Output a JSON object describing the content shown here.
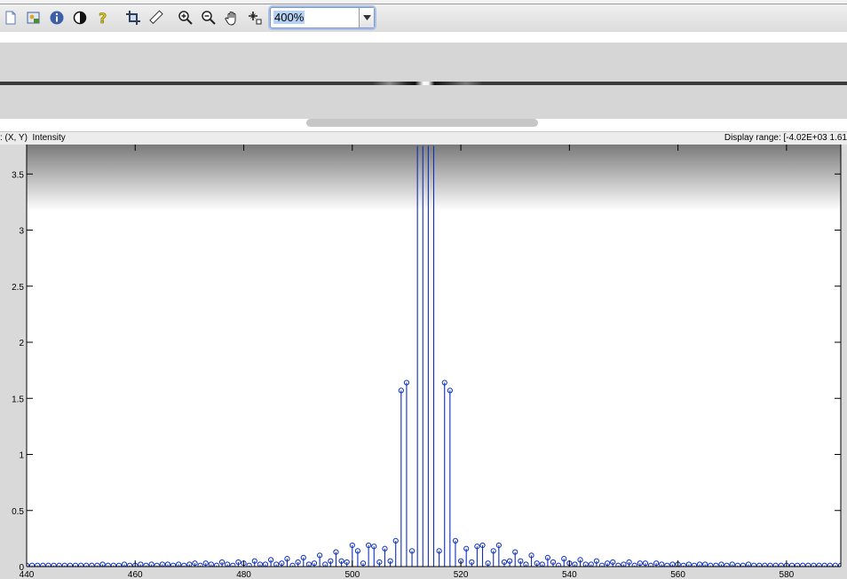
{
  "toolbar": {
    "icons": [
      "new-document-icon",
      "open-image-icon",
      "info-icon",
      "contrast-icon",
      "help-icon",
      "crop-icon",
      "measure-distance-icon",
      "zoom-in-icon",
      "zoom-out-icon",
      "pan-hand-icon",
      "pixel-region-icon"
    ],
    "zoom_value": "400%"
  },
  "status": {
    "pixel_info_label": ": (X, Y)  Intensity",
    "display_range_label": "Display range: [-4.02E+03 1.61"
  },
  "colors": {
    "stem": "#0c2fbe",
    "axes_bg": "#ffffff",
    "panel_bg": "#d9d9d9"
  },
  "chart_data": {
    "type": "scatter",
    "style": "stem",
    "x_range": [
      440,
      590
    ],
    "y_range": [
      0,
      3.75
    ],
    "x_ticks": [
      "440",
      "460",
      "480",
      "500",
      "520",
      "540",
      "560",
      "580"
    ],
    "y_ticks": [
      "0",
      "0.5",
      "1",
      "1.5",
      "2",
      "2.5",
      "3",
      "3.5"
    ],
    "grid": false,
    "x": [
      440,
      441,
      442,
      443,
      444,
      445,
      446,
      447,
      448,
      449,
      450,
      451,
      452,
      453,
      454,
      455,
      456,
      457,
      458,
      459,
      460,
      461,
      462,
      463,
      464,
      465,
      466,
      467,
      468,
      469,
      470,
      471,
      472,
      473,
      474,
      475,
      476,
      477,
      478,
      479,
      480,
      481,
      482,
      483,
      484,
      485,
      486,
      487,
      488,
      489,
      490,
      491,
      492,
      493,
      494,
      495,
      496,
      497,
      498,
      499,
      500,
      501,
      502,
      503,
      504,
      505,
      506,
      507,
      508,
      509,
      510,
      511,
      512,
      513,
      514,
      515,
      516,
      517,
      518,
      519,
      520,
      521,
      522,
      523,
      524,
      525,
      526,
      527,
      528,
      529,
      530,
      531,
      532,
      533,
      534,
      535,
      536,
      537,
      538,
      539,
      540,
      541,
      542,
      543,
      544,
      545,
      546,
      547,
      548,
      549,
      550,
      551,
      552,
      553,
      554,
      555,
      556,
      557,
      558,
      559,
      560,
      561,
      562,
      563,
      564,
      565,
      566,
      567,
      568,
      569,
      570,
      571,
      572,
      573,
      574,
      575,
      576,
      577,
      578,
      579,
      580,
      581,
      582,
      583,
      584,
      585,
      586,
      587,
      588,
      589,
      590
    ],
    "y": [
      0.01,
      0.01,
      0.01,
      0.01,
      0.01,
      0.01,
      0.01,
      0.01,
      0.01,
      0.01,
      0.01,
      0.01,
      0.01,
      0.01,
      0.02,
      0.01,
      0.01,
      0.01,
      0.02,
      0.01,
      0.01,
      0.02,
      0.01,
      0.02,
      0.01,
      0.02,
      0.02,
      0.01,
      0.02,
      0.01,
      0.02,
      0.03,
      0.01,
      0.03,
      0.02,
      0.01,
      0.04,
      0.02,
      0.01,
      0.04,
      0.03,
      0.01,
      0.05,
      0.02,
      0.02,
      0.06,
      0.02,
      0.03,
      0.07,
      0.01,
      0.04,
      0.08,
      0.02,
      0.03,
      0.1,
      0.02,
      0.05,
      0.13,
      0.05,
      0.04,
      0.19,
      0.14,
      0.03,
      0.19,
      0.18,
      0.04,
      0.16,
      0.05,
      0.23,
      1.57,
      1.64,
      0.14,
      3.75,
      3.75,
      3.75,
      3.75,
      0.14,
      1.64,
      1.57,
      0.23,
      0.05,
      0.16,
      0.04,
      0.18,
      0.19,
      0.03,
      0.14,
      0.19,
      0.04,
      0.05,
      0.13,
      0.05,
      0.02,
      0.1,
      0.03,
      0.02,
      0.08,
      0.04,
      0.01,
      0.07,
      0.03,
      0.02,
      0.06,
      0.02,
      0.02,
      0.05,
      0.01,
      0.03,
      0.04,
      0.01,
      0.02,
      0.04,
      0.01,
      0.03,
      0.03,
      0.01,
      0.03,
      0.02,
      0.01,
      0.02,
      0.02,
      0.01,
      0.02,
      0.01,
      0.02,
      0.02,
      0.01,
      0.01,
      0.02,
      0.01,
      0.02,
      0.01,
      0.01,
      0.02,
      0.01,
      0.01,
      0.01,
      0.01,
      0.01,
      0.01,
      0.01,
      0.01,
      0.01,
      0.01,
      0.01,
      0.01,
      0.01,
      0.01,
      0.01,
      0.01,
      0.01
    ]
  }
}
